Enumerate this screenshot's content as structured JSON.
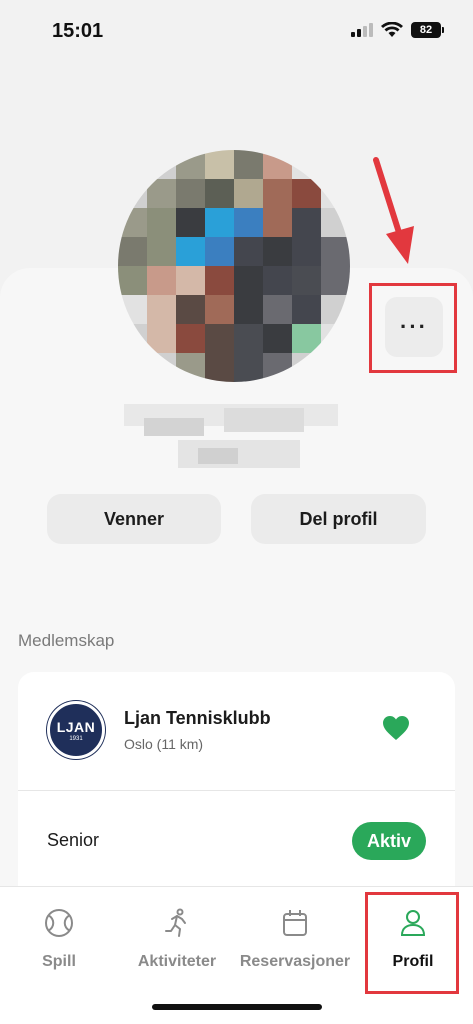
{
  "status_bar": {
    "time": "15:01",
    "battery": "82"
  },
  "profile": {
    "more_button_label": "···",
    "friends_button": "Venner",
    "share_button": "Del profil"
  },
  "membership": {
    "section_label": "Medlemskap",
    "club": {
      "logo_text": "LJAN",
      "logo_year": "1931",
      "name": "Ljan Tennisklubb",
      "location": "Oslo (11 km)"
    },
    "category": "Senior",
    "status": "Aktiv"
  },
  "tabs": [
    {
      "label": "Spill",
      "icon": "tennis-ball-icon"
    },
    {
      "label": "Aktiviteter",
      "icon": "running-person-icon"
    },
    {
      "label": "Reservasjoner",
      "icon": "calendar-icon"
    },
    {
      "label": "Profil",
      "icon": "person-icon",
      "active": true
    }
  ],
  "colors": {
    "accent_green": "#2aa85a",
    "annotation_red": "#e2383e",
    "club_navy": "#1f2f5a"
  }
}
